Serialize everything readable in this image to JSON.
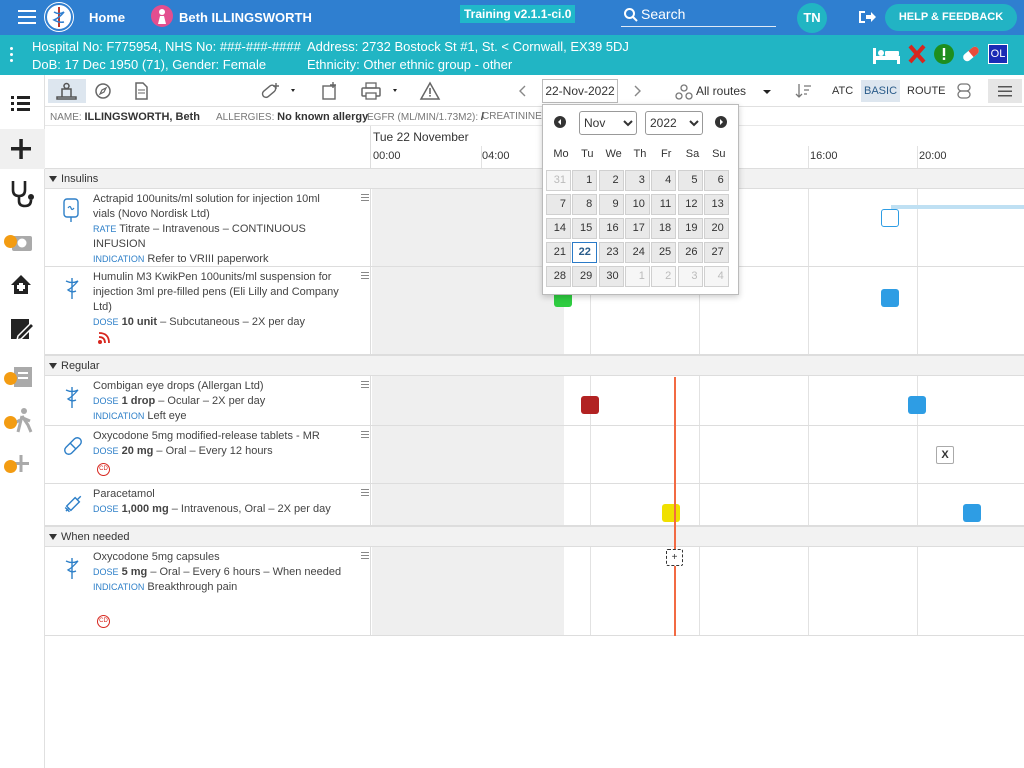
{
  "topbar": {
    "home_label": "Home",
    "patient_name": "Beth ILLINGSWORTH",
    "version": "Training v2.1.1-ci.0",
    "search_placeholder": "Search",
    "user_initials": "TN",
    "help_label": "HELP & FEEDBACK"
  },
  "banner": {
    "hospital_line": "Hospital No: F775954, NHS No: ###-###-####",
    "dob_line": "DoB: 17 Dec 1950 (71), Gender: Female",
    "address_line": "Address: 2732 Bostock St #1, St. < Cornwall, EX39 5DJ",
    "ethnicity_line": "Ethnicity: Other ethnic group - other",
    "ol_badge": "OL"
  },
  "toolbar": {
    "date_value": "22-Nov-2022",
    "routes_label": "All routes",
    "tab_atc": "ATC",
    "tab_basic": "BASIC",
    "tab_route": "ROUTE"
  },
  "infoline": {
    "name_label": "NAME:",
    "name_value": "ILLINGSWORTH, Beth",
    "allergies_label": "ALLERGIES:",
    "allergies_value": "No known allergy",
    "egfr_label": "EGFR (ML/MIN/1.73M2):",
    "egfr_value": "/",
    "creatinine_label": "CREATININE (UM"
  },
  "timeline": {
    "date_label": "Tue 22 November",
    "hours": [
      "00:00",
      "04:00",
      "16:00",
      "20:00"
    ]
  },
  "sections": {
    "insulins": "Insulins",
    "regular": "Regular",
    "when_needed": "When needed"
  },
  "drugs": {
    "actrapid": {
      "name": "Actrapid 100units/ml solution for injection 10ml vials (Novo Nordisk Ltd)",
      "rate_label": "RATE",
      "rate_value": "Titrate – Intravenous – CONTINUOUS INFUSION",
      "indication_label": "INDICATION",
      "indication_value": "Refer to VRIII paperwork"
    },
    "humulin": {
      "name": "Humulin M3 KwikPen 100units/ml suspension for injection 3ml pre-filled pens (Eli Lilly and Company Ltd)",
      "dose_label": "DOSE",
      "dose_amount": "10 unit",
      "dose_rest": " – Subcutaneous – 2X per day"
    },
    "combigan": {
      "name": "Combigan eye drops (Allergan Ltd)",
      "dose_label": "DOSE",
      "dose_amount": "1 drop",
      "dose_rest": " – Ocular – 2X per day",
      "indication_label": "INDICATION",
      "indication_value": "Left eye"
    },
    "oxycodone_mr": {
      "name": "Oxycodone 5mg modified-release tablets - MR",
      "dose_label": "DOSE",
      "dose_amount": "20 mg",
      "dose_rest": " – Oral – Every 12 hours",
      "cd_badge": "CD"
    },
    "paracetamol": {
      "name": "Paracetamol",
      "dose_label": "DOSE",
      "dose_amount": "1,000 mg",
      "dose_rest": " – Intravenous, Oral – 2X per day"
    },
    "oxycodone_caps": {
      "name": "Oxycodone 5mg capsules",
      "dose_label": "DOSE",
      "dose_amount": "5 mg",
      "dose_rest": " – Oral – Every 6 hours – When needed",
      "indication_label": "INDICATION",
      "indication_value": "Breakthrough pain",
      "cd_badge": "CD"
    }
  },
  "markers": {
    "omitted_label": "X",
    "add_label": "+"
  },
  "datepicker": {
    "month": "Nov",
    "year": "2022",
    "weekdays": [
      "Mo",
      "Tu",
      "We",
      "Th",
      "Fr",
      "Sa",
      "Su"
    ],
    "weeks": [
      [
        "31",
        "1",
        "2",
        "3",
        "4",
        "5",
        "6"
      ],
      [
        "7",
        "8",
        "9",
        "10",
        "11",
        "12",
        "13"
      ],
      [
        "14",
        "15",
        "16",
        "17",
        "18",
        "19",
        "20"
      ],
      [
        "21",
        "22",
        "23",
        "24",
        "25",
        "26",
        "27"
      ],
      [
        "28",
        "29",
        "30",
        "1",
        "2",
        "3",
        "4"
      ]
    ],
    "selected_day": "22"
  },
  "colors": {
    "topbar": "#2f7fd0",
    "banner": "#21b5c4",
    "now_line": "#f26a43",
    "given_green": "#2ecc40",
    "due_blue": "#2e9de4",
    "missed_red": "#b22222",
    "yellow": "#f0e000"
  }
}
